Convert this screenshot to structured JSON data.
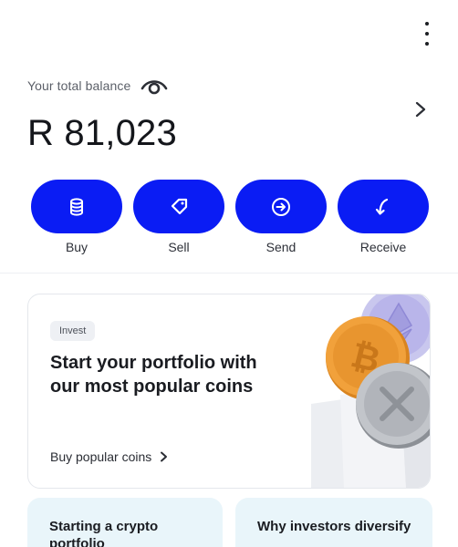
{
  "header": {
    "menu_icon": "more-vertical-icon"
  },
  "balance": {
    "label": "Your total balance",
    "amount": "R 81,023",
    "visibility_icon": "eye-icon",
    "details_icon": "chevron-right-icon"
  },
  "actions": [
    {
      "label": "Buy",
      "icon": "coins-stack-icon"
    },
    {
      "label": "Sell",
      "icon": "tag-icon"
    },
    {
      "label": "Send",
      "icon": "arrow-right-circle-icon"
    },
    {
      "label": "Receive",
      "icon": "receive-arrow-icon"
    }
  ],
  "invest_card": {
    "badge": "Invest",
    "title": "Start your portfolio with our most popular coins",
    "link": "Buy popular coins",
    "art": [
      "ethereum-coin",
      "bitcoin-coin",
      "xrp-coin"
    ]
  },
  "learn_cards": [
    {
      "title": "Starting a crypto portfolio"
    },
    {
      "title": "Why investors diversify"
    }
  ],
  "colors": {
    "accent": "#0a1cf4",
    "card_bg": "#e9f5fa",
    "text": "#16181d",
    "muted": "#5b5f68"
  }
}
